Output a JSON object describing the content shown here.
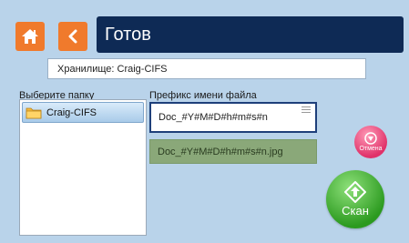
{
  "header": {
    "title": "Готов",
    "home_icon": "home-icon",
    "back_icon": "chevron-left-icon"
  },
  "storage": {
    "text": "Хранилище: Craig-CIFS"
  },
  "folders": {
    "label": "Выберите папку",
    "items": [
      {
        "label": "Craig-CIFS",
        "icon": "folder-icon",
        "selected": true
      }
    ]
  },
  "filename": {
    "label": "Префикс имени файла",
    "value": "Doc_#Y#M#D#h#m#s#n",
    "preview": "Doc_#Y#M#D#h#m#s#n.jpg"
  },
  "actions": {
    "cancel_label": "Отмена",
    "scan_label": "Скан"
  },
  "colors": {
    "background": "#b9d3ea",
    "accent_orange": "#f07a2c",
    "title_bar": "#0e2a55",
    "cancel": "#e0326a",
    "scan": "#2b9a1f",
    "preview": "#8aa879"
  }
}
